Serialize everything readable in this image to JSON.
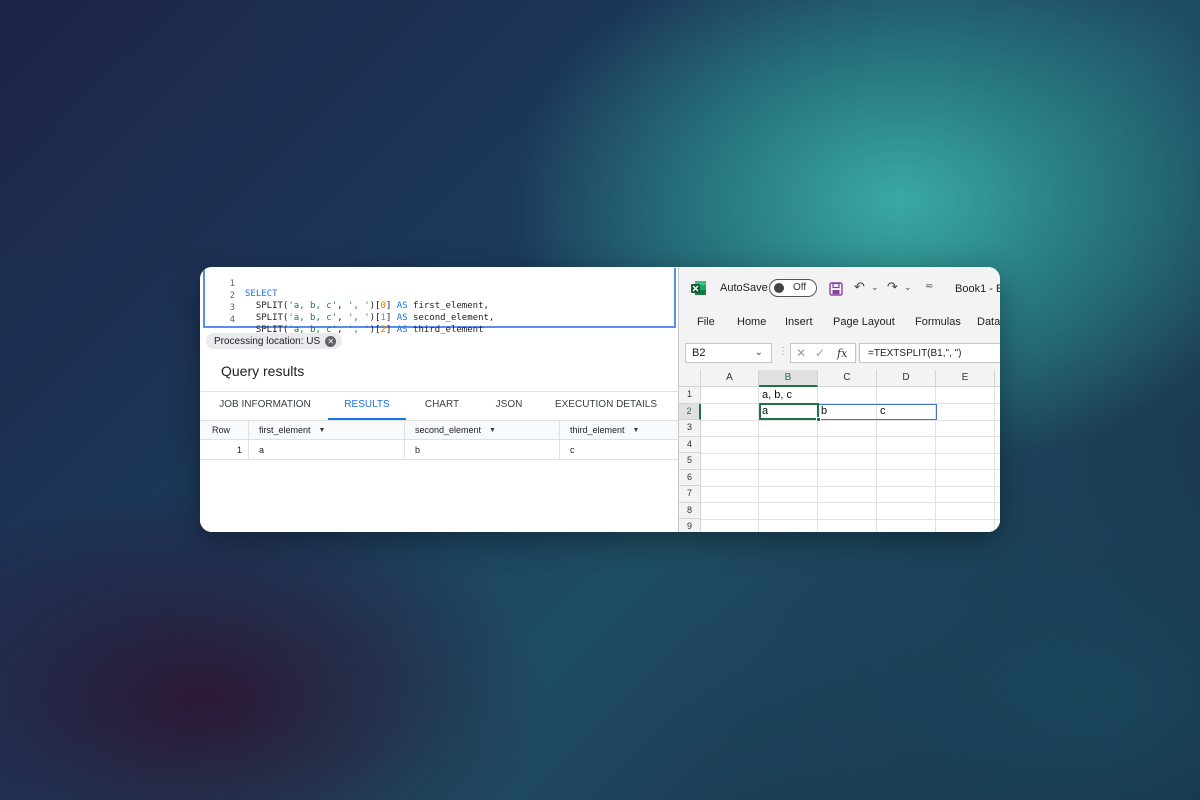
{
  "bigquery": {
    "code_lines": [
      {
        "num": "1",
        "text": "SELECT"
      },
      {
        "num": "2",
        "text": "  SPLIT('a, b, c', ', ')[0] AS first_element,"
      },
      {
        "num": "3",
        "text": "  SPLIT('a, b, c', ', ')[1] AS second_element,"
      },
      {
        "num": "4",
        "text": "  SPLIT('a, b, c', ', ')[2] AS third_element"
      }
    ],
    "processing_location": "Processing location: US",
    "results_title": "Query results",
    "tabs": [
      "JOB INFORMATION",
      "RESULTS",
      "CHART",
      "JSON",
      "EXECUTION DETAILS"
    ],
    "active_tab": "RESULTS",
    "columns": [
      "Row",
      "first_element",
      "second_element",
      "third_element"
    ],
    "rows": [
      {
        "row": "1",
        "first_element": "a",
        "second_element": "b",
        "third_element": "c"
      }
    ]
  },
  "excel": {
    "autosave_label": "AutoSave",
    "autosave_state": "Off",
    "book_title": "Book1 - E",
    "menu": [
      "File",
      "Home",
      "Insert",
      "Page Layout",
      "Formulas",
      "Data"
    ],
    "name_box": "B2",
    "formula": "=TEXTSPLIT(B1,\", \")",
    "columns": [
      "A",
      "B",
      "C",
      "D",
      "E"
    ],
    "rows": [
      "1",
      "2",
      "3",
      "4",
      "5",
      "6",
      "7",
      "8",
      "9"
    ],
    "cells": {
      "B1": "a, b, c",
      "B2": "a",
      "C2": "b",
      "D2": "c"
    },
    "accent": "#217346"
  },
  "colors": {
    "bq_accent": "#1a73e8",
    "excel_green": "#217346"
  }
}
